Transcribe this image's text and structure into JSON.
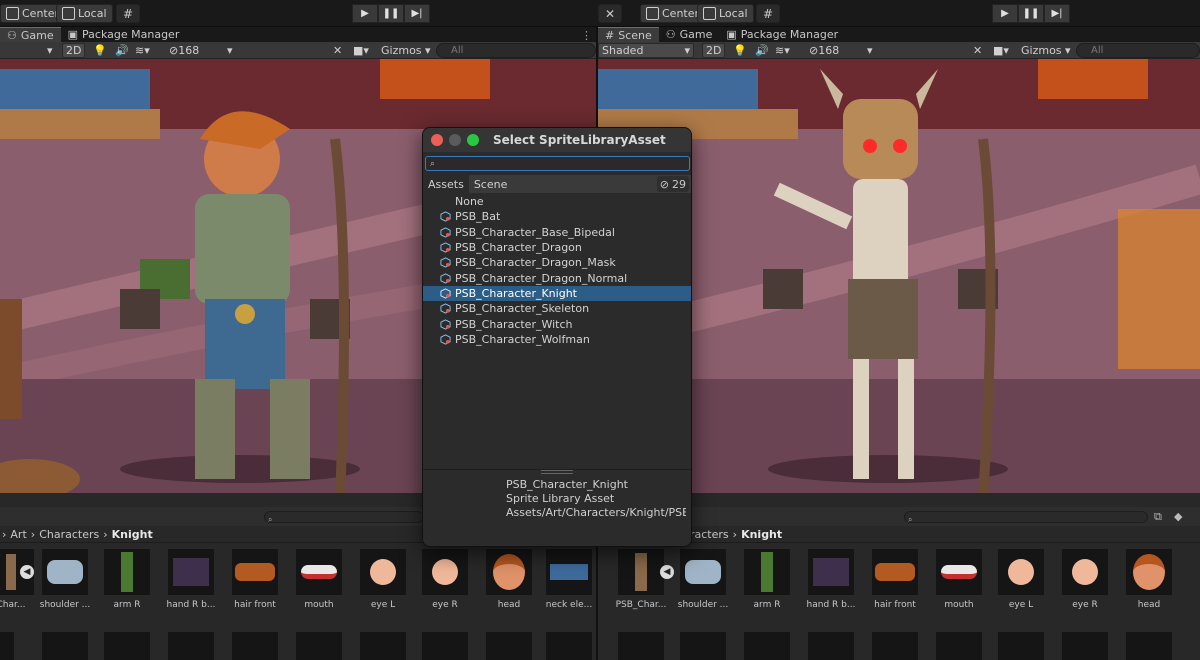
{
  "toolbar": {
    "left": {
      "center_label": "Center",
      "local_label": "Local"
    },
    "right": {
      "center_label": "Center",
      "local_label": "Local"
    }
  },
  "left_view": {
    "tabs": [
      {
        "label": "Game"
      },
      {
        "label": "Package Manager"
      }
    ],
    "two_d": "2D",
    "layers_count": "168",
    "gizmos": "Gizmos",
    "search_placeholder": "All"
  },
  "right_view": {
    "tabs": [
      {
        "label": "Scene"
      },
      {
        "label": "Game"
      },
      {
        "label": "Package Manager"
      }
    ],
    "shading": "Shaded",
    "two_d": "2D",
    "layers_count": "168",
    "gizmos": "Gizmos",
    "search_placeholder": "All"
  },
  "modal": {
    "title": "Select SpriteLibraryAsset",
    "tabs": [
      "Assets",
      "Scene"
    ],
    "hidden_count": "29",
    "items": [
      {
        "label": "None"
      },
      {
        "label": "PSB_Bat"
      },
      {
        "label": "PSB_Character_Base_Bipedal"
      },
      {
        "label": "PSB_Character_Dragon"
      },
      {
        "label": "PSB_Character_Dragon_Mask"
      },
      {
        "label": "PSB_Character_Dragon_Normal"
      },
      {
        "label": "PSB_Character_Knight",
        "selected": true
      },
      {
        "label": "PSB_Character_Skeleton"
      },
      {
        "label": "PSB_Character_Witch"
      },
      {
        "label": "PSB_Character_Wolfman"
      }
    ],
    "info": {
      "name": "PSB_Character_Knight",
      "type": "Sprite Library Asset",
      "path": "Assets/Art/Characters/Knight/PSB"
    }
  },
  "left_project": {
    "breadcrumb": [
      "Art",
      "Characters",
      "Knight"
    ],
    "assets": [
      "Char...",
      "shoulder ...",
      "arm R",
      "hand R b...",
      "hair front",
      "mouth",
      "eye L",
      "eye R",
      "head",
      "neck ele..."
    ]
  },
  "right_project": {
    "breadcrumb_partial": "racters",
    "breadcrumb_current": "Knight",
    "assets": [
      "PSB_Char...",
      "shoulder ...",
      "arm R",
      "hand R b...",
      "hair front",
      "mouth",
      "eye L",
      "eye R",
      "head"
    ]
  },
  "colors": {
    "accent": "#3a79bb",
    "selection": "#2c5d87",
    "close": "#ec5f57",
    "minimize": "#5b5b5b",
    "zoom": "#2ac742"
  }
}
